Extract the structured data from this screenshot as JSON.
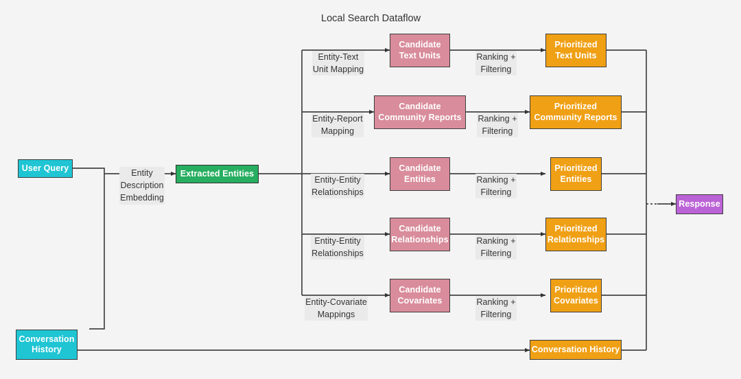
{
  "diagram": {
    "title": "Local Search Dataflow",
    "background_color": "#f4f4f4",
    "type": "flowchart",
    "colors": {
      "input": "#20c5d4",
      "extraction": "#27ae60",
      "candidate": "#d98c9b",
      "prioritized": "#f0a015",
      "response": "#bb62d6",
      "edge": "#333333",
      "text": "#333333"
    },
    "nodes": {
      "user_query": "User Query",
      "conversation_history_input": "Conversation\nHistory",
      "extracted_entities": "Extracted Entities",
      "candidate_text_units": "Candidate\nText Units",
      "candidate_community_reports": "Candidate\nCommunity Reports",
      "candidate_entities": "Candidate\nEntities",
      "candidate_relationships": "Candidate\nRelationships",
      "candidate_covariates": "Candidate\nCovariates",
      "prioritized_text_units": "Prioritized\nText Units",
      "prioritized_community_reports": "Prioritized\nCommunity Reports",
      "prioritized_entities": "Prioritized\nEntities",
      "prioritized_relationships": "Prioritized\nRelationships",
      "prioritized_covariates": "Prioritized\nCovariates",
      "conversation_history_output": "Conversation History",
      "response": "Response"
    },
    "edge_labels": {
      "entity_description_embedding": "Entity\nDescription\nEmbedding",
      "entity_text_unit_mapping": "Entity-Text\nUnit Mapping",
      "entity_report_mapping": "Entity-Report\nMapping",
      "entity_entity_relationships_1": "Entity-Entity\nRelationships",
      "entity_entity_relationships_2": "Entity-Entity\nRelationships",
      "entity_covariate_mappings": "Entity-Covariate\nMappings",
      "ranking_filtering_1": "Ranking +\nFiltering",
      "ranking_filtering_2": "Ranking +\nFiltering",
      "ranking_filtering_3": "Ranking +\nFiltering",
      "ranking_filtering_4": "Ranking +\nFiltering",
      "ranking_filtering_5": "Ranking +\nFiltering"
    }
  }
}
